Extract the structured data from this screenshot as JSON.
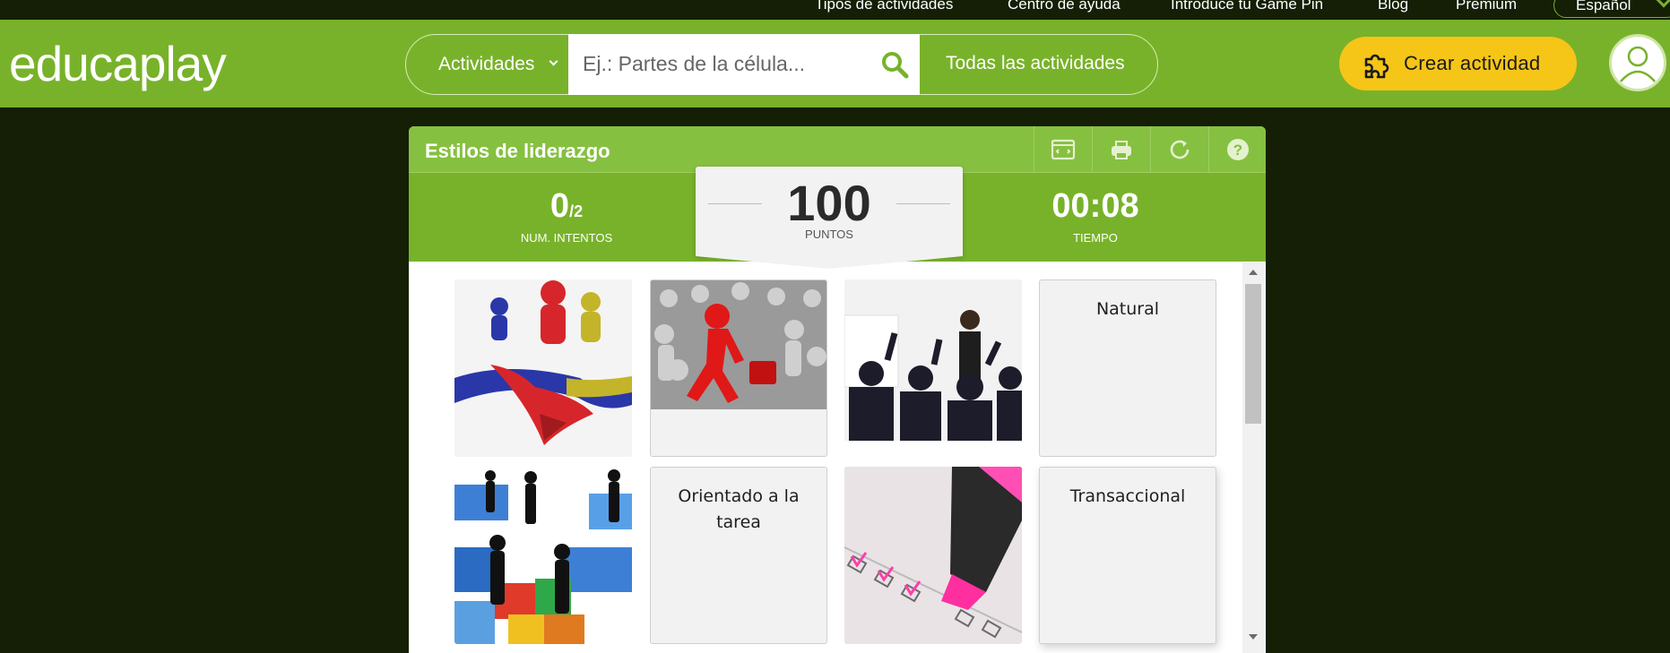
{
  "topnav": {
    "links": [
      "Tipos de actividades",
      "Centro de ayuda",
      "Introduce tu Game Pin",
      "Blog",
      "Premium"
    ],
    "language": "Español"
  },
  "header": {
    "logo": "educaplay",
    "search": {
      "category": "Actividades",
      "placeholder": "Ej.: Partes de la célula...",
      "all_label": "Todas las actividades"
    },
    "create_label": "Crear actividad"
  },
  "activity": {
    "title": "Estilos de liderazgo",
    "toolbar_icons": [
      "fullscreen-icon",
      "print-icon",
      "restart-icon",
      "help-icon"
    ],
    "attempts": {
      "value": "0",
      "total": "/2",
      "label": "NUM. INTENTOS"
    },
    "score": {
      "value": "100",
      "label": "PUNTOS"
    },
    "time": {
      "value": "00:08",
      "label": "TIEMPO"
    },
    "cards": [
      {
        "type": "image",
        "icon": "figures-arrow-image"
      },
      {
        "type": "image",
        "icon": "red-figure-crowd-image"
      },
      {
        "type": "image",
        "icon": "meeting-cheering-image"
      },
      {
        "type": "text",
        "text": "Natural"
      },
      {
        "type": "image",
        "icon": "puzzle-handshake-image"
      },
      {
        "type": "text",
        "text": "Orientado a la tarea"
      },
      {
        "type": "image",
        "icon": "checklist-marker-image"
      },
      {
        "type": "text",
        "text": "Transaccional"
      }
    ]
  },
  "colors": {
    "header_green": "#78b22a",
    "title_green": "#86c040",
    "dark_bg": "#141f06",
    "create_yellow": "#f5c518"
  }
}
